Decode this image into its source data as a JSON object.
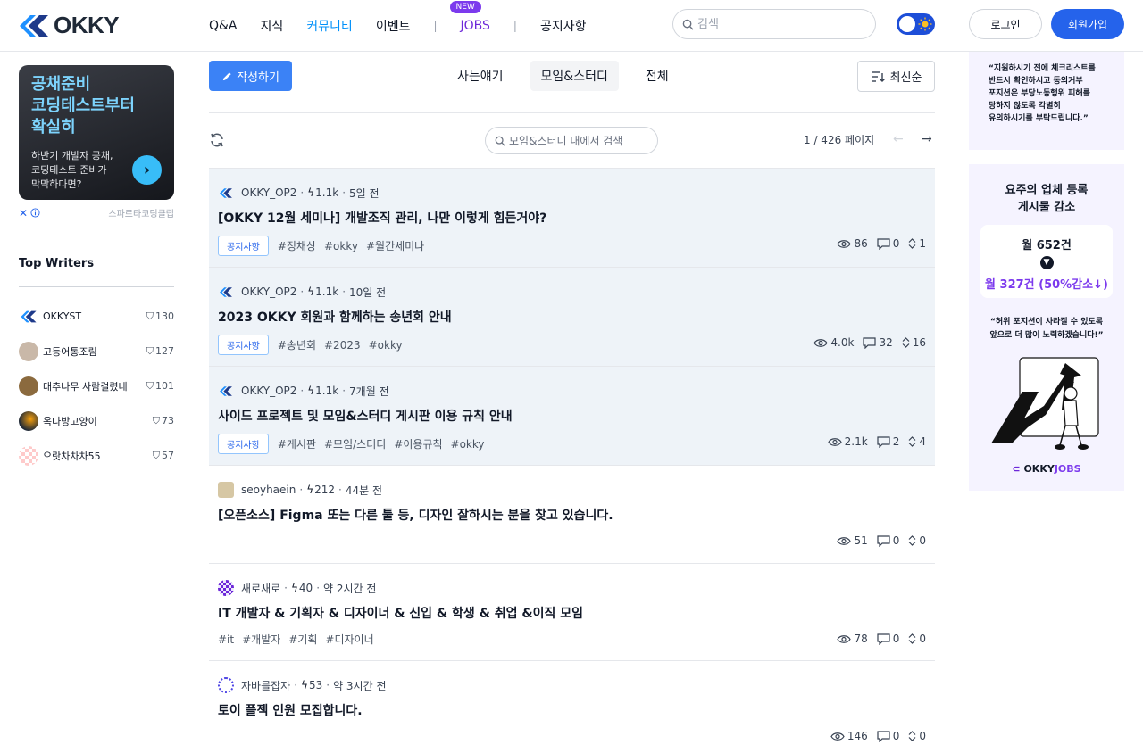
{
  "header": {
    "logo_text": "OKKY",
    "nav": [
      {
        "label": "Q&A",
        "active": false
      },
      {
        "label": "지식",
        "active": false
      },
      {
        "label": "커뮤니티",
        "active": true
      },
      {
        "label": "이벤트",
        "active": false
      }
    ],
    "jobs_label": "JOBS",
    "jobs_badge": "NEW",
    "notice_label": "공지사항",
    "search_placeholder": "검색",
    "login_label": "로그인",
    "signup_label": "회원가입"
  },
  "ad": {
    "title_lines": [
      "공채준비",
      "코딩테스트부터",
      "확실히"
    ],
    "subtitle_lines": [
      "하반기 개발자 공채,",
      "코딩테스트 준비가",
      "막막하다면?"
    ],
    "advertiser": "스파르타코딩클럽",
    "close_icon": "x-icon",
    "info_icon": "info-icon"
  },
  "top_writers": {
    "title": "Top Writers",
    "items": [
      {
        "name": "OKKYST",
        "score": "130"
      },
      {
        "name": "고등어통조림",
        "score": "127"
      },
      {
        "name": "대추나무 사람걸렸네",
        "score": "101"
      },
      {
        "name": "옥다방고양이",
        "score": "73"
      },
      {
        "name": "으랏차차차55",
        "score": "57"
      }
    ]
  },
  "toolbar": {
    "write_label": "작성하기",
    "tabs": [
      {
        "label": "사는얘기",
        "selected": false
      },
      {
        "label": "모임&스터디",
        "selected": true
      },
      {
        "label": "전체",
        "selected": false
      }
    ],
    "sort_label": "최신순",
    "board_search_placeholder": "모임&스터디 내에서 검색",
    "pagination": "1 / 426 페이지"
  },
  "posts": [
    {
      "notice": true,
      "author": "OKKY_OP2",
      "points": "1.1k",
      "time": "5일 전",
      "title": "[OKKY 12월 세미나] 개발조직 관리, 나만 이렇게 힘든거야?",
      "badge": "공지사항",
      "tags": [
        "#정채상",
        "#okky",
        "#월간세미나"
      ],
      "views": "86",
      "comments": "0",
      "votes": "1"
    },
    {
      "notice": true,
      "author": "OKKY_OP2",
      "points": "1.1k",
      "time": "10일 전",
      "title": "2023 OKKY 회원과 함께하는 송년회 안내",
      "badge": "공지사항",
      "tags": [
        "#송년회",
        "#2023",
        "#okky"
      ],
      "views": "4.0k",
      "comments": "32",
      "votes": "16"
    },
    {
      "notice": true,
      "author": "OKKY_OP2",
      "points": "1.1k",
      "time": "7개월 전",
      "title": "사이드 프로젝트 및 모임&스터디 게시판 이용 규칙 안내",
      "badge": "공지사항",
      "tags": [
        "#게시판",
        "#모임/스터디",
        "#이용규칙",
        "#okky"
      ],
      "views": "2.1k",
      "comments": "2",
      "votes": "4"
    },
    {
      "notice": false,
      "author": "seoyhaein",
      "points": "212",
      "time": "44분 전",
      "title": "[오픈소스] Figma 또는 다른 툴 등, 디자인 잘하시는 분을 찾고 있습니다.",
      "badge": "",
      "tags": [],
      "views": "51",
      "comments": "0",
      "votes": "0"
    },
    {
      "notice": false,
      "author": "새로새로",
      "points": "40",
      "time": "약 2시간 전",
      "title": "IT 개발자 & 기획자 & 디자이너 & 신입 & 학생 & 취업 &이직 모임",
      "badge": "",
      "tags": [
        "#it",
        "#개발자",
        "#기획",
        "#디자이너"
      ],
      "views": "78",
      "comments": "0",
      "votes": "0"
    },
    {
      "notice": false,
      "author": "자바를잡자",
      "points": "53",
      "time": "약 3시간 전",
      "title": "토이 플젝 인원 모집합니다.",
      "badge": "",
      "tags": [],
      "views": "146",
      "comments": "0",
      "votes": "0"
    }
  ],
  "right": {
    "quote1_lines": [
      "“지원하시기 전에 체크리스트를",
      "반드시 확인하시고 동의거부",
      "포지션은 부당노동행위 피해를",
      "당하지 않도록 각별히",
      "유의하시기를 부탁드립니다.”"
    ],
    "promo_title_lines": [
      "요주의 업체 등록",
      "게시물 감소"
    ],
    "stat_before": "월 652건",
    "stat_after": "월 327건 (50%감소↓)",
    "quote2_lines": [
      "“허위 포지션이 사라질 수 있도록",
      "앞으로 더 많이 노력하겠습니다!”"
    ],
    "jobs_logo_main": "OKKY",
    "jobs_logo_accent": "JOBS"
  },
  "colors": {
    "primary": "#3b82f6",
    "active_nav": "#0090f9",
    "notice_bg": "#eef3f8",
    "accent_purple": "#7c3aed"
  }
}
